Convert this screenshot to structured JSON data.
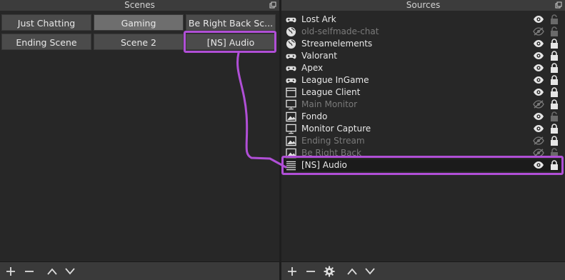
{
  "scenes": {
    "title": "Scenes",
    "buttons": [
      {
        "label": "Just Chatting",
        "active": false
      },
      {
        "label": "Gaming",
        "active": true
      },
      {
        "label": "Be Right Back Sc...",
        "active": false
      },
      {
        "label": "Ending Scene",
        "active": false
      },
      {
        "label": "Scene 2",
        "active": false
      },
      {
        "label": "[NS] Audio",
        "active": false,
        "highlighted": true
      }
    ]
  },
  "sources": {
    "title": "Sources",
    "items": [
      {
        "name": "Lost Ark",
        "icon": "gamepad-icon",
        "visible": true,
        "locked": false
      },
      {
        "name": "old-selfmade-chat",
        "icon": "globe-icon",
        "visible": false,
        "locked": false
      },
      {
        "name": "Streamelements",
        "icon": "globe-icon",
        "visible": true,
        "locked": true
      },
      {
        "name": "Valorant",
        "icon": "gamepad-icon",
        "visible": true,
        "locked": true
      },
      {
        "name": "Apex",
        "icon": "gamepad-icon",
        "visible": true,
        "locked": true
      },
      {
        "name": "League InGame",
        "icon": "gamepad-icon",
        "visible": true,
        "locked": true
      },
      {
        "name": "League Client",
        "icon": "window-icon",
        "visible": true,
        "locked": true
      },
      {
        "name": "Main Monitor",
        "icon": "monitor-icon",
        "visible": false,
        "locked": true
      },
      {
        "name": "Fondo",
        "icon": "image-icon",
        "visible": true,
        "locked": false
      },
      {
        "name": "Monitor Capture",
        "icon": "monitor-icon",
        "visible": true,
        "locked": true
      },
      {
        "name": "Ending Stream",
        "icon": "image-icon",
        "visible": false,
        "locked": true
      },
      {
        "name": "Be Right Back",
        "icon": "image-icon",
        "visible": false,
        "locked": false
      },
      {
        "name": "[NS] Audio",
        "icon": "list-icon",
        "visible": true,
        "locked": true,
        "highlighted": true
      }
    ]
  },
  "colors": {
    "highlight": "#b04fd6"
  },
  "scenes_toolbar": [
    "add-icon",
    "remove-icon",
    "up-icon",
    "down-icon"
  ],
  "sources_toolbar": [
    "add-icon",
    "remove-icon",
    "gear-icon",
    "up-icon",
    "down-icon"
  ]
}
